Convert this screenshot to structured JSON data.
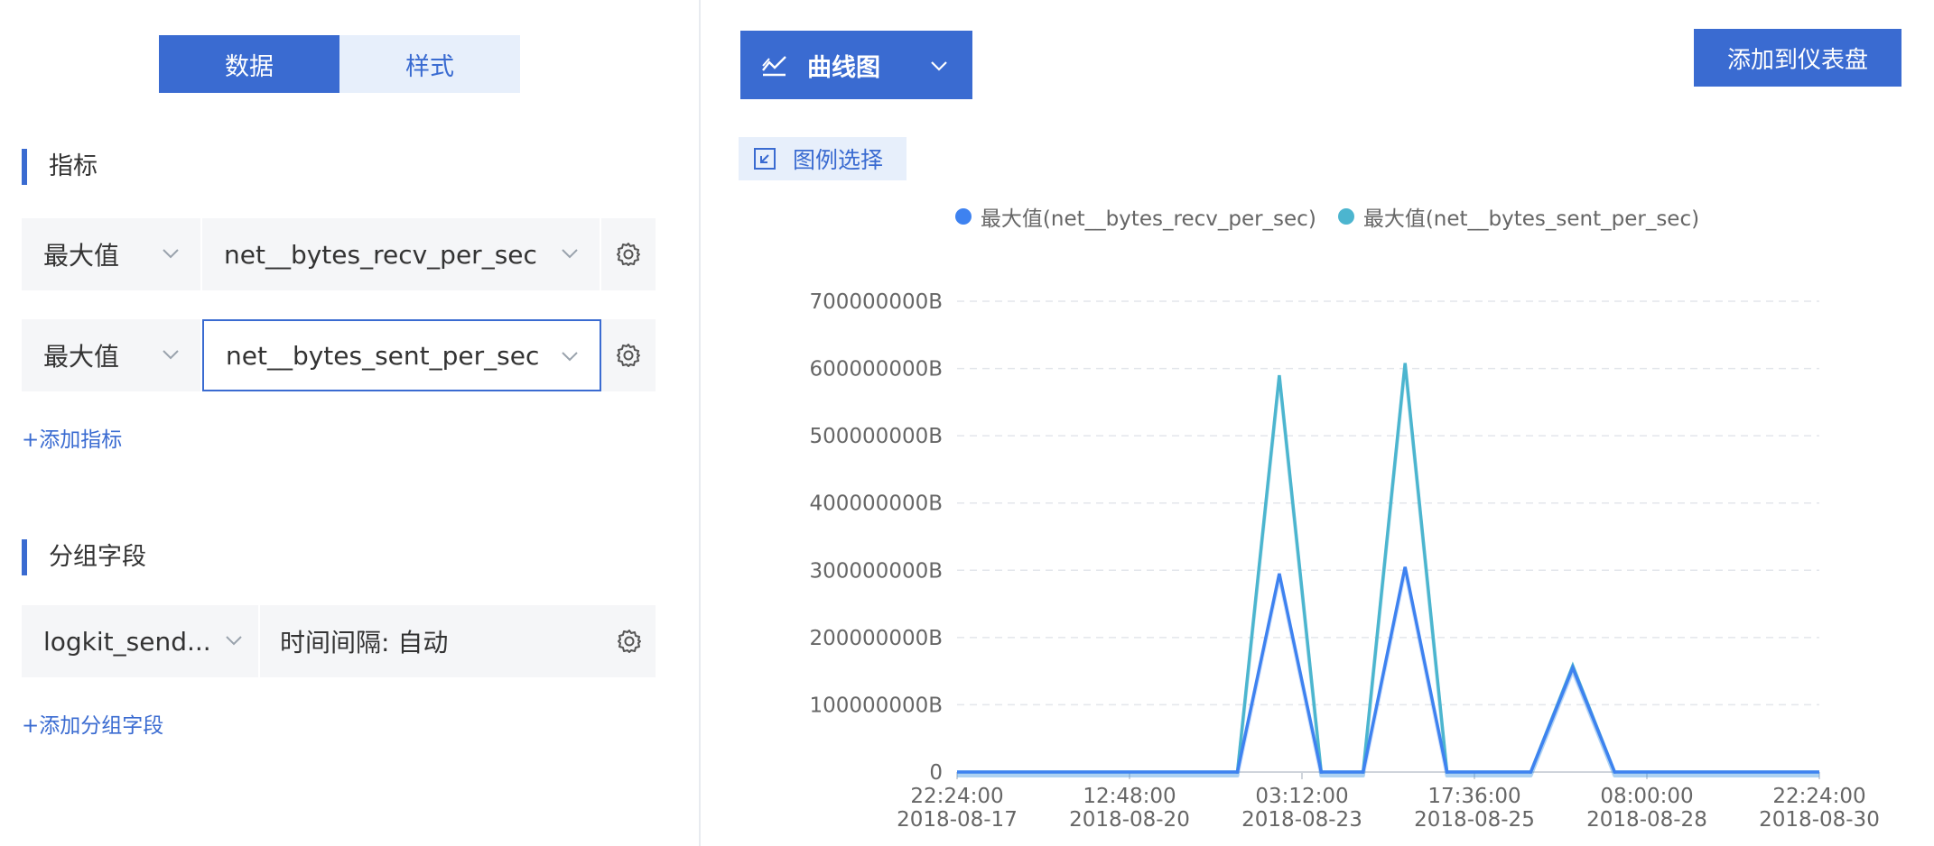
{
  "tabs": [
    {
      "label": "数据",
      "active": true
    },
    {
      "label": "样式",
      "active": false
    }
  ],
  "metrics_section": {
    "title": "指标"
  },
  "metrics": [
    {
      "aggregation": "最大值",
      "field": "net__bytes_recv_per_sec",
      "selected": false
    },
    {
      "aggregation": "最大值",
      "field": "net__bytes_sent_per_sec",
      "selected": true
    }
  ],
  "add_metric_label": "+添加指标",
  "group_section": {
    "title": "分组字段"
  },
  "group": {
    "field": "logkit_send...",
    "interval": "时间间隔: 自动"
  },
  "add_group_label": "+添加分组字段",
  "chart_type": {
    "label": "曲线图",
    "icon": "line-chart-icon"
  },
  "add_to_dashboard_label": "添加到仪表盘",
  "legend_select_label": "图例选择",
  "colors": {
    "primary": "#3a6bd1",
    "series1": "#3e82f0",
    "series2": "#4cb5cf",
    "grid": "#e3e6eb"
  },
  "chart_data": {
    "type": "line",
    "title": "",
    "legend_position": "top-center",
    "grid": true,
    "y_ticks": [
      "0",
      "100000000B",
      "200000000B",
      "300000000B",
      "400000000B",
      "500000000B",
      "600000000B",
      "700000000B"
    ],
    "ylim": [
      0,
      700000000
    ],
    "x_ticks": [
      {
        "time": "22:24:00",
        "date": "2018-08-17"
      },
      {
        "time": "12:48:00",
        "date": "2018-08-20"
      },
      {
        "time": "03:12:00",
        "date": "2018-08-23"
      },
      {
        "time": "17:36:00",
        "date": "2018-08-25"
      },
      {
        "time": "08:00:00",
        "date": "2018-08-28"
      },
      {
        "time": "22:24:00",
        "date": "2018-08-30"
      }
    ],
    "x": [
      "2018-08-17 22:24",
      "2018-08-18 23:40",
      "2018-08-20 01:00",
      "2018-08-21 02:20",
      "2018-08-22 03:50",
      "2018-08-22 19:00",
      "2018-08-23 10:10",
      "2018-08-24 01:20",
      "2018-08-24 16:30",
      "2018-08-25 07:40",
      "2018-08-25 22:50",
      "2018-08-26 14:00",
      "2018-08-27 05:10",
      "2018-08-27 20:20",
      "2018-08-29 00:00",
      "2018-08-30 22:24"
    ],
    "series": [
      {
        "name": "最大值(net__bytes_recv_per_sec)",
        "values": [
          0,
          0,
          0,
          0,
          0,
          295000000,
          0,
          0,
          305000000,
          0,
          0,
          0,
          155000000,
          0,
          0,
          0
        ]
      },
      {
        "name": "最大值(net__bytes_sent_per_sec)",
        "values": [
          0,
          0,
          0,
          0,
          0,
          590000000,
          0,
          0,
          608000000,
          0,
          0,
          0,
          158000000,
          0,
          0,
          0
        ]
      }
    ]
  }
}
